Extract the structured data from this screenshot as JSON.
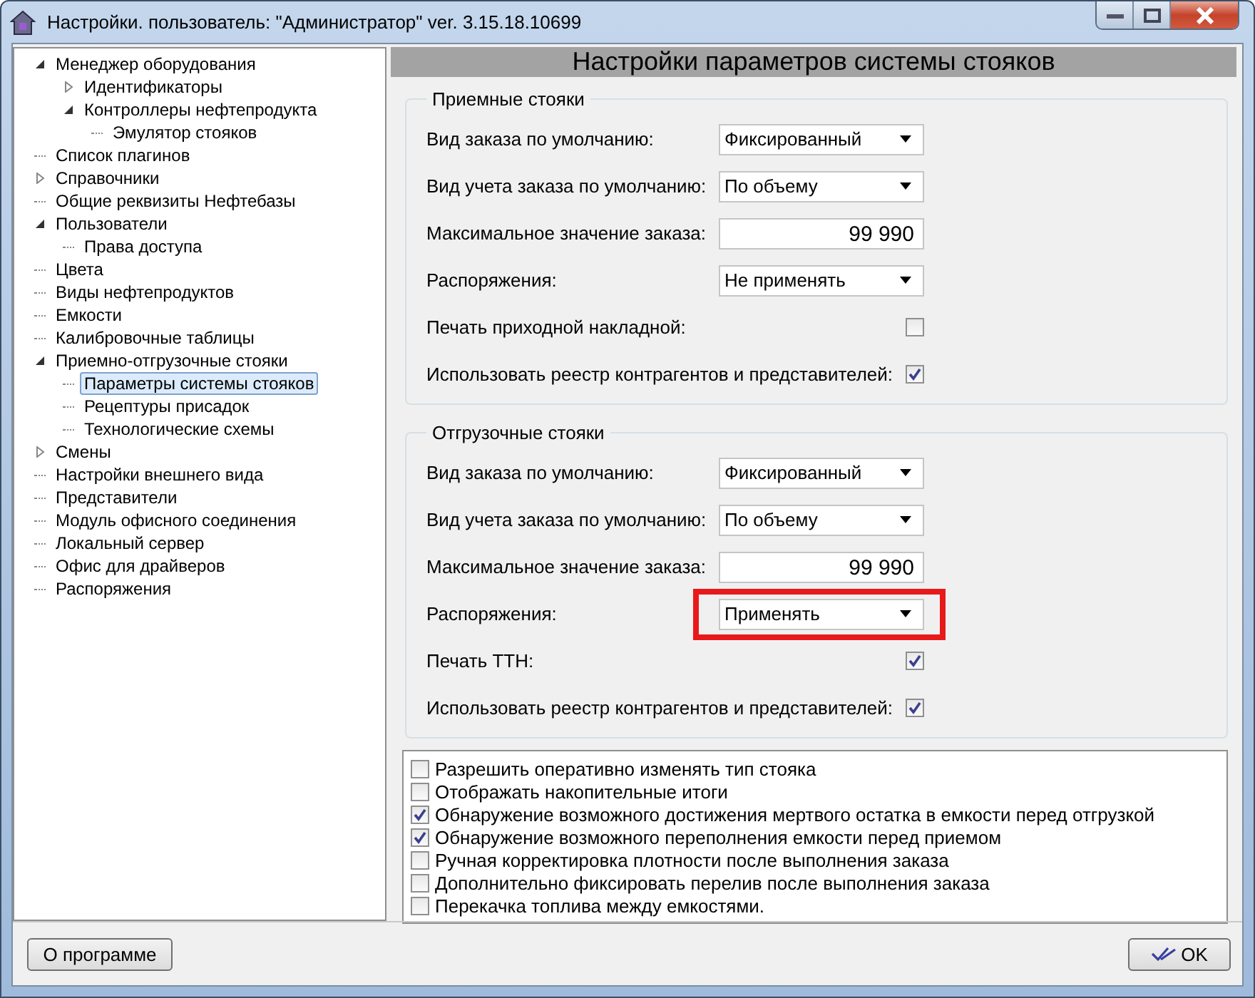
{
  "window": {
    "title": "Настройки. пользователь: \"Администратор\" ver. 3.15.18.10699"
  },
  "tree": [
    {
      "label": "Менеджер оборудования",
      "selected": false,
      "expanded": true,
      "children": [
        {
          "label": "Идентификаторы",
          "selected": false,
          "expanded": false
        },
        {
          "label": "Контроллеры нефтепродукта",
          "selected": false,
          "expanded": true,
          "children": [
            {
              "label": "Эмулятор стояков",
              "selected": false
            }
          ]
        }
      ]
    },
    {
      "label": "Список плагинов",
      "selected": false
    },
    {
      "label": "Справочники",
      "selected": false,
      "expanded": false
    },
    {
      "label": "Общие реквизиты Нефтебазы",
      "selected": false
    },
    {
      "label": "Пользователи",
      "selected": false,
      "expanded": true,
      "children": [
        {
          "label": "Права доступа",
          "selected": false
        }
      ]
    },
    {
      "label": "Цвета",
      "selected": false
    },
    {
      "label": "Виды нефтепродуктов",
      "selected": false
    },
    {
      "label": "Емкости",
      "selected": false
    },
    {
      "label": "Калибровочные таблицы",
      "selected": false
    },
    {
      "label": "Приемно-отгрузочные стояки",
      "selected": false,
      "expanded": true,
      "children": [
        {
          "label": "Параметры системы стояков",
          "selected": true
        },
        {
          "label": "Рецептуры присадок",
          "selected": false
        },
        {
          "label": "Технологические схемы",
          "selected": false
        }
      ]
    },
    {
      "label": "Смены",
      "selected": false,
      "expanded": false
    },
    {
      "label": "Настройки внешнего вида",
      "selected": false
    },
    {
      "label": "Представители",
      "selected": false
    },
    {
      "label": "Модуль офисного соединения",
      "selected": false
    },
    {
      "label": "Локальный сервер",
      "selected": false
    },
    {
      "label": "Офис для драйверов",
      "selected": false
    },
    {
      "label": "Распоряжения",
      "selected": false
    }
  ],
  "panel_title": "Настройки параметров системы стояков",
  "groups": [
    {
      "title": "Приемные стояки",
      "rows": [
        {
          "kind": "select",
          "label": "Вид заказа по умолчанию:",
          "value": "Фиксированный",
          "highlighted": false
        },
        {
          "kind": "select",
          "label": "Вид учета заказа по умолчанию:",
          "value": "По объему",
          "highlighted": false
        },
        {
          "kind": "number",
          "label": "Максимальное значение заказа:",
          "value": "99 990"
        },
        {
          "kind": "select",
          "label": "Распоряжения:",
          "value": "Не применять",
          "highlighted": false
        },
        {
          "kind": "checkbox",
          "label": "Печать приходной накладной:",
          "checked": false
        },
        {
          "kind": "checkbox",
          "label": "Использовать реестр контрагентов и представителей:",
          "checked": true
        }
      ]
    },
    {
      "title": "Отгрузочные стояки",
      "rows": [
        {
          "kind": "select",
          "label": "Вид заказа по умолчанию:",
          "value": "Фиксированный",
          "highlighted": false
        },
        {
          "kind": "select",
          "label": "Вид учета заказа по умолчанию:",
          "value": "По объему",
          "highlighted": false
        },
        {
          "kind": "number",
          "label": "Максимальное значение заказа:",
          "value": "99 990"
        },
        {
          "kind": "select",
          "label": "Распоряжения:",
          "value": "Применять",
          "highlighted": true
        },
        {
          "kind": "checkbox",
          "label": "Печать ТТН:",
          "checked": true
        },
        {
          "kind": "checkbox",
          "label": "Использовать реестр контрагентов и представителей:",
          "checked": true
        }
      ]
    }
  ],
  "options": [
    {
      "label": "Разрешить оперативно изменять тип стояка",
      "checked": false
    },
    {
      "label": "Отображать накопительные итоги",
      "checked": false
    },
    {
      "label": "Обнаружение возможного достижения мертвого остатка в емкости перед отгрузкой",
      "checked": true
    },
    {
      "label": "Обнаружение возможного переполнения емкости перед приемом",
      "checked": true
    },
    {
      "label": "Ручная корректировка плотности после выполнения заказа",
      "checked": false
    },
    {
      "label": "Дополнительно фиксировать перелив после выполнения заказа",
      "checked": false
    },
    {
      "label": "Перекачка топлива между емкостями.",
      "checked": false
    }
  ],
  "buttons": {
    "about": "О программе",
    "ok": "OK"
  }
}
